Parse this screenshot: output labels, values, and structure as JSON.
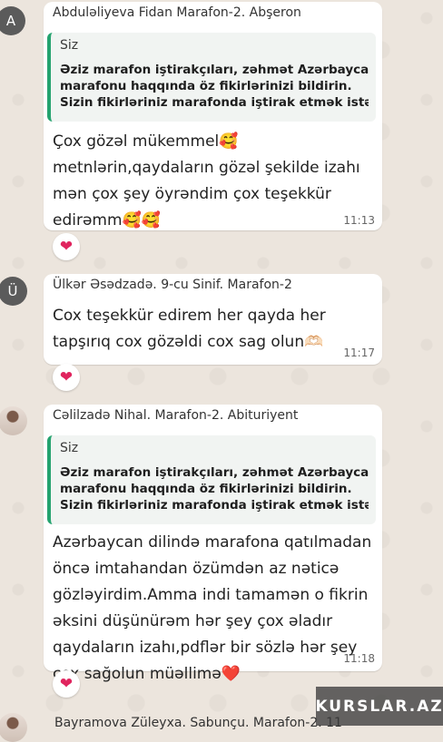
{
  "messages": [
    {
      "avatar": "A",
      "sender": "Abdulǝliyeva Fidan Marafon-2. Abşeron",
      "quote": {
        "author": "Siz",
        "lines": [
          "Əziz marafon iştirakçıları, zəhmət Azərbaycan",
          "marafonu haqqında öz fikirlərinizi bildirin.",
          "Sizin fikirləriniz marafonda iştirak etmək istə..."
        ]
      },
      "text": "Çox gözəl mükemmel🥰\nmetnlərin,qaydaların gözəl şekilde izahı\nmən çox şey öyrəndim çox teşekkür\nedirəmm🥰🥰",
      "time": "11:13",
      "reaction": "❤"
    },
    {
      "avatar": "Ü",
      "sender": "Ülkər Əsədzadə. 9-cu Sinif. Marafon-2",
      "text": "Cox teşekkür edirem her qayda her\ntapşırıq cox gözəldi cox sag olun🫶🏻",
      "time": "11:17",
      "reaction": "❤"
    },
    {
      "sender": "Cəlilzadə Nihal. Marafon-2. Abituriyent",
      "quote": {
        "author": "Siz",
        "lines": [
          "Əziz marafon iştirakçıları, zəhmət Azərbaycan",
          "marafonu haqqında öz fikirlərinizi bildirin.",
          "Sizin fikirləriniz marafonda iştirak etmək istə..."
        ]
      },
      "text": "Azərbaycan dilində marafona qatılmadan\nöncə imtahandan özümdən az nəticə\ngözləyirdim.Amma indi tamamən o fikrin\nəksini düşünürəm hər şey çox əladır\nqaydaların izahı,pdflər bir sözlə hər şey\nçox sağolun müəllimə❤️",
      "time": "11:18",
      "reaction": "❤"
    }
  ],
  "next_sender": "Bayramova Züleyxa. Sabunçu. Marafon-2. 11",
  "watermark": "KURSLAR.AZ"
}
